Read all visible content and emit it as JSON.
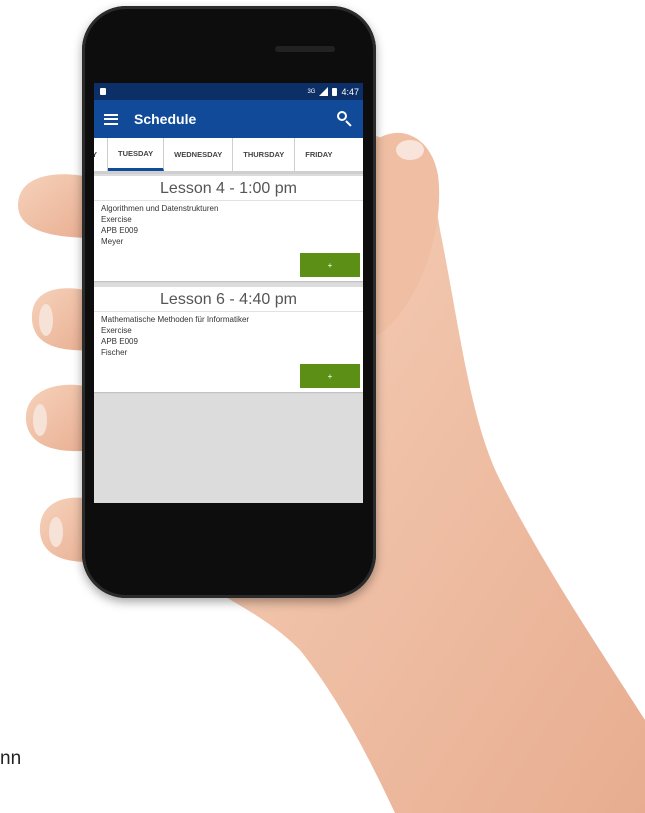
{
  "statusbar": {
    "network": "3G",
    "time": "4:47"
  },
  "appbar": {
    "title": "Schedule"
  },
  "tabs": [
    {
      "label": "Y",
      "active": false
    },
    {
      "label": "TUESDAY",
      "active": true
    },
    {
      "label": "WEDNESDAY",
      "active": false
    },
    {
      "label": "THURSDAY",
      "active": false
    },
    {
      "label": "FRIDAY",
      "active": false
    }
  ],
  "lessons": [
    {
      "title": "Lesson 4 - 1:00 pm",
      "course": "Algorithmen und Datenstrukturen",
      "type": "Exercise",
      "room": "APB E009",
      "teacher": "Meyer",
      "button_label": "+"
    },
    {
      "title": "Lesson 6 - 4:40 pm",
      "course": "Mathematische Methoden für Informatiker",
      "type": "Exercise",
      "room": "APB E009",
      "teacher": "Fischer",
      "button_label": "+"
    }
  ],
  "corner_text": "nn",
  "colors": {
    "statusbar": "#0b2f66",
    "appbar": "#114a98",
    "button": "#5b8f15",
    "skin": "#f2c3a8"
  }
}
